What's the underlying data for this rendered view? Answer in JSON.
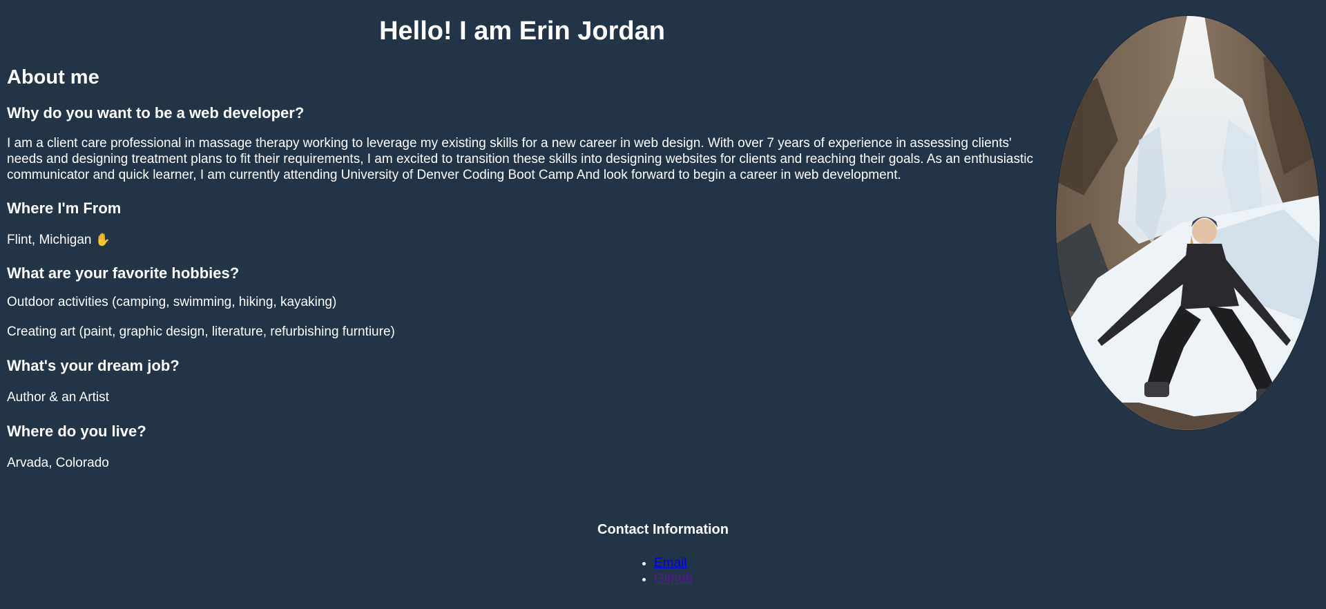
{
  "header": {
    "title": "Hello! I am Erin Jordan"
  },
  "about": {
    "heading": "About me",
    "why_question": "Why do you want to be a web developer?",
    "why_answer": "I am a client care professional in massage therapy working to leverage my existing skills for a new career in web design. With over 7 years of experience in assessing clients' needs and designing treatment plans to fit their requirements, I am excited to transition these skills into designing websites for clients and reaching their goals. As an enthusiastic communicator and quick learner, I am currently attending University of Denver Coding Boot Camp And look forward to begin a career in web development.",
    "from_question": "Where I'm From",
    "from_answer": "Flint, Michigan",
    "from_icon": "raised-hand-icon",
    "from_icon_glyph": "✋",
    "hobbies_question": "What are your favorite hobbies?",
    "hobby_1": "Outdoor activities (camping, swimming, hiking, kayaking)",
    "hobby_2": "Creating art (paint, graphic design, literature, refurbishing furntiure)",
    "job_question": "What's your dream job?",
    "job_answer": "Author & an Artist",
    "live_question": "Where do you live?",
    "live_answer": "Arvada, Colorado"
  },
  "contact": {
    "heading": "Contact Information",
    "links": [
      "Email",
      "Github"
    ]
  },
  "colors": {
    "background": "#243447",
    "text": "#ffffff",
    "link": "#0000ee",
    "visited_link": "#551a8b"
  }
}
